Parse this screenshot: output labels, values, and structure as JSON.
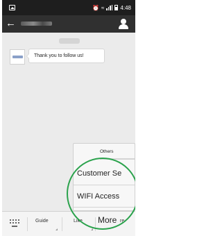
{
  "status_bar": {
    "time": "4:48",
    "icons": [
      "image-icon",
      "alarm-icon",
      "wifi-icon",
      "signal-icon",
      "battery-icon"
    ]
  },
  "header": {
    "title": "",
    "icons": [
      "back-arrow-icon",
      "profile-icon"
    ]
  },
  "chat": {
    "timestamp": "",
    "messages": [
      {
        "text": "Thank you to follow us!"
      }
    ]
  },
  "popup_menu": {
    "items": [
      {
        "label": "Others"
      },
      {
        "label": "Customer Se"
      },
      {
        "label": "WIFI Access"
      }
    ]
  },
  "bottom_menu": {
    "keyboard_icon": "keyboard-icon",
    "items": [
      {
        "label": "Guide"
      },
      {
        "label": "Like"
      },
      {
        "label": "More"
      }
    ],
    "more_suffix": "re"
  },
  "colors": {
    "status_bar": "#1e1e1e",
    "title_bar": "#303030",
    "chat_background": "#ebebeb",
    "highlight_circle": "#2aa24c"
  }
}
